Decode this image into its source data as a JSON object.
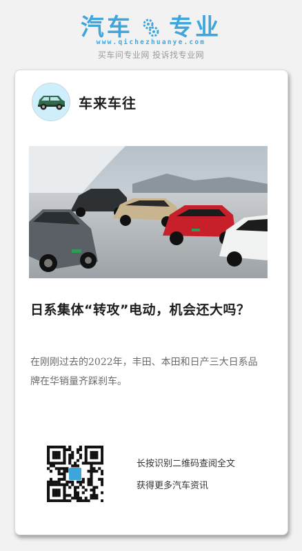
{
  "brand": {
    "logo_left": "汽车",
    "logo_right": "专业",
    "url": "www.qichezhuanye.com",
    "slogan": "买车问专业网 投诉找专业网",
    "logo_color": "#3fa6dc"
  },
  "card": {
    "channel_name": "车来车往",
    "avatar_icon": "car-avatar-icon",
    "hero_image": "toyota-bz-suv-lineup-photo",
    "title": "日系集体“转攻”电动，机会还大吗？",
    "summary": "在刚刚过去的2022年，丰田、本田和日产三大日系品牌在华销量齐踩刹车。",
    "qr_icon": "qr-code-icon",
    "qr_hint_1": "长按识别二维码查阅全文",
    "qr_hint_2": "获得更多汽车资讯"
  }
}
